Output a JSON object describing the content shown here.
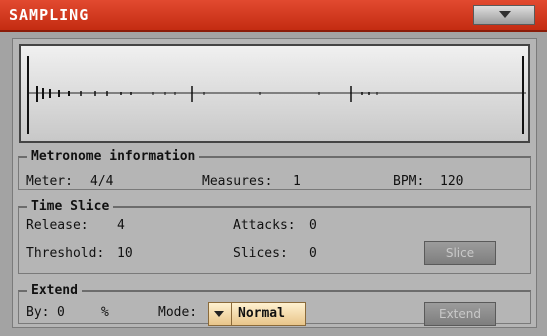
{
  "window": {
    "title": "SAMPLING"
  },
  "metronome": {
    "legend": "Metronome information",
    "meter_label": "Meter:",
    "meter_value": "4/4",
    "measures_label": "Measures:",
    "measures_value": "1",
    "bpm_label": "BPM:",
    "bpm_value": "120"
  },
  "time_slice": {
    "legend": "Time Slice",
    "release_label": "Release:",
    "release_value": "4",
    "attacks_label": "Attacks:",
    "attacks_value": "0",
    "threshold_label": "Threshold:",
    "threshold_value": "10",
    "slices_label": "Slices:",
    "slices_value": "0",
    "slice_button": "Slice"
  },
  "extend": {
    "legend": "Extend",
    "by_label": "By:",
    "by_value": "0",
    "unit": "%",
    "mode_label": "Mode:",
    "mode_value": "Normal",
    "extend_button": "Extend"
  },
  "colors": {
    "titlebar": "#d43a1f",
    "dropdown": "#f2d7a3"
  }
}
